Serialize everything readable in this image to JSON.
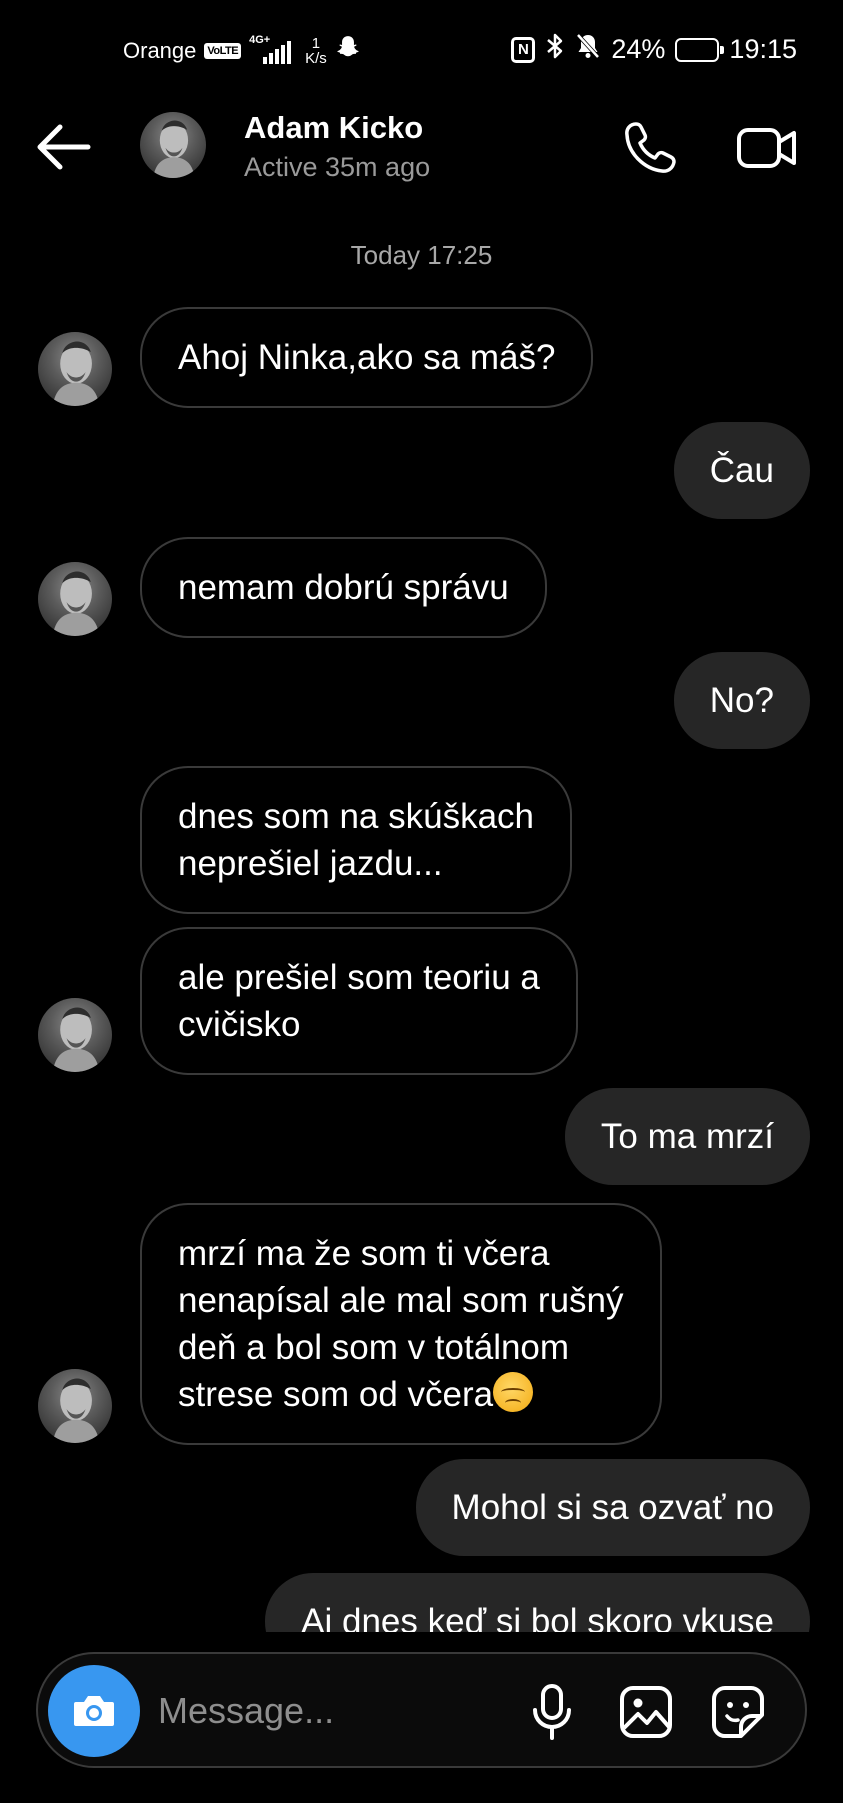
{
  "status_bar": {
    "carrier": "Orange",
    "volte": "VoLTE",
    "network": "4G+",
    "speed_value": "1",
    "speed_unit": "K/s",
    "nfc": "N",
    "battery_percent": "24%",
    "battery_level": 0.24,
    "time": "19:15"
  },
  "header": {
    "contact_name": "Adam Kicko",
    "contact_status": "Active 35m ago"
  },
  "thread": {
    "timestamp": "Today 17:25",
    "messages": [
      {
        "direction": "incoming",
        "lines": [
          "Ahoj Ninka,ako sa máš?"
        ]
      },
      {
        "direction": "outgoing",
        "lines": [
          "Čau"
        ]
      },
      {
        "direction": "incoming",
        "lines": [
          "nemam dobrú správu"
        ]
      },
      {
        "direction": "outgoing",
        "lines": [
          "No?"
        ]
      },
      {
        "direction": "incoming",
        "lines": [
          "dnes som na skúškach",
          "neprešiel jazdu..."
        ]
      },
      {
        "direction": "incoming",
        "lines": [
          "ale prešiel som teoriu a",
          "cvičisko"
        ]
      },
      {
        "direction": "outgoing",
        "lines": [
          "To ma mrzí"
        ]
      },
      {
        "direction": "incoming",
        "lines": [
          "mrzí ma že som ti včera",
          "nenapísal ale mal som rušný",
          "deň a bol som v totálnom",
          "strese som od včera"
        ],
        "emoji": "pensive-face"
      },
      {
        "direction": "outgoing",
        "lines": [
          "Mohol si sa ozvať no"
        ]
      },
      {
        "direction": "outgoing",
        "lines": [
          "Aj dnes keď si bol skoro vkuse"
        ]
      }
    ]
  },
  "composer": {
    "placeholder": "Message..."
  },
  "colors": {
    "background": "#000000",
    "outgoing_bubble": "#262626",
    "incoming_border": "#3a3a3a",
    "camera_button": "#3897f0",
    "secondary_text": "#9a9a9a"
  }
}
